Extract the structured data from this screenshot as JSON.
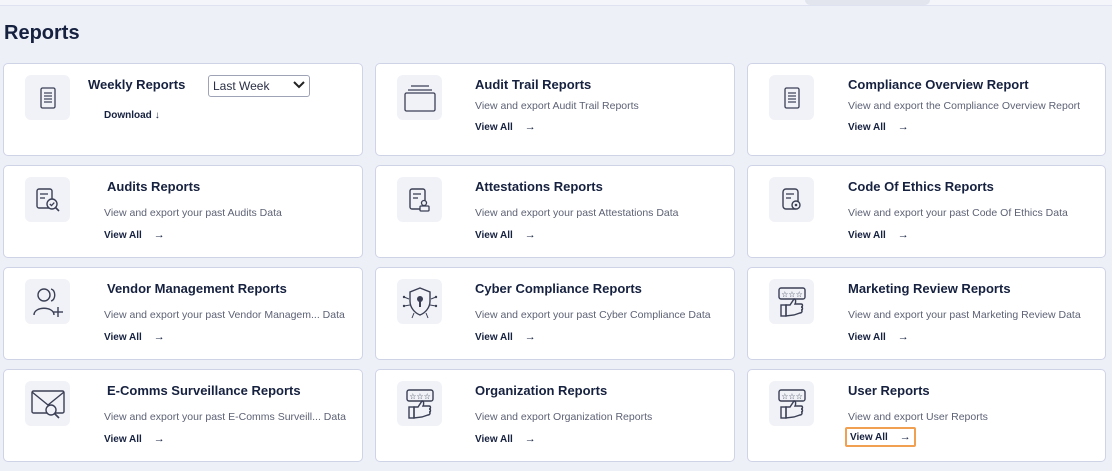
{
  "page": {
    "title": "Reports"
  },
  "weekly": {
    "title": "Weekly Reports",
    "select_value": "Last Week",
    "download_label": "Download",
    "download_icon": "↓"
  },
  "arrow": "→",
  "cards": [
    {
      "title": "Audit Trail Reports",
      "desc": "View and export Audit Trail Reports",
      "link": "View All",
      "icon": "tray-icon"
    },
    {
      "title": "Compliance Overview Report",
      "desc": "View and export the Compliance Overview Report",
      "link": "View All",
      "icon": "document-icon"
    },
    {
      "title": "Audits Reports",
      "desc": "View and export your past Audits Data",
      "link": "View All",
      "icon": "audit-check-icon"
    },
    {
      "title": "Attestations Reports",
      "desc": "View and export your past Attestations Data",
      "link": "View All",
      "icon": "attestation-icon"
    },
    {
      "title": "Code Of Ethics Reports",
      "desc": "View and export your past Code Of Ethics Data",
      "link": "View All",
      "icon": "ethics-icon"
    },
    {
      "title": "Vendor Management Reports",
      "desc": "View and export your past Vendor Managem...  Data",
      "link": "View All",
      "icon": "add-user-icon"
    },
    {
      "title": "Cyber Compliance Reports",
      "desc": "View and export your past Cyber Compliance Data",
      "link": "View All",
      "icon": "shield-lock-icon"
    },
    {
      "title": "Marketing Review Reports",
      "desc": "View and export your past Marketing Review Data",
      "link": "View All",
      "icon": "review-thumbs-icon"
    },
    {
      "title": "E-Comms Surveillance Reports",
      "desc": "View and export your past E-Comms Surveill...  Data",
      "link": "View All",
      "icon": "mail-search-icon"
    },
    {
      "title": "Organization Reports",
      "desc": "View and export Organization Reports",
      "link": "View All",
      "icon": "review-thumbs-icon"
    },
    {
      "title": "User Reports",
      "desc": "View and export User Reports",
      "link": "View All",
      "icon": "review-thumbs-icon"
    }
  ],
  "colors": {
    "accent_highlight": "#f0a050",
    "card_border": "#cfd3e6",
    "title": "#16213f"
  }
}
